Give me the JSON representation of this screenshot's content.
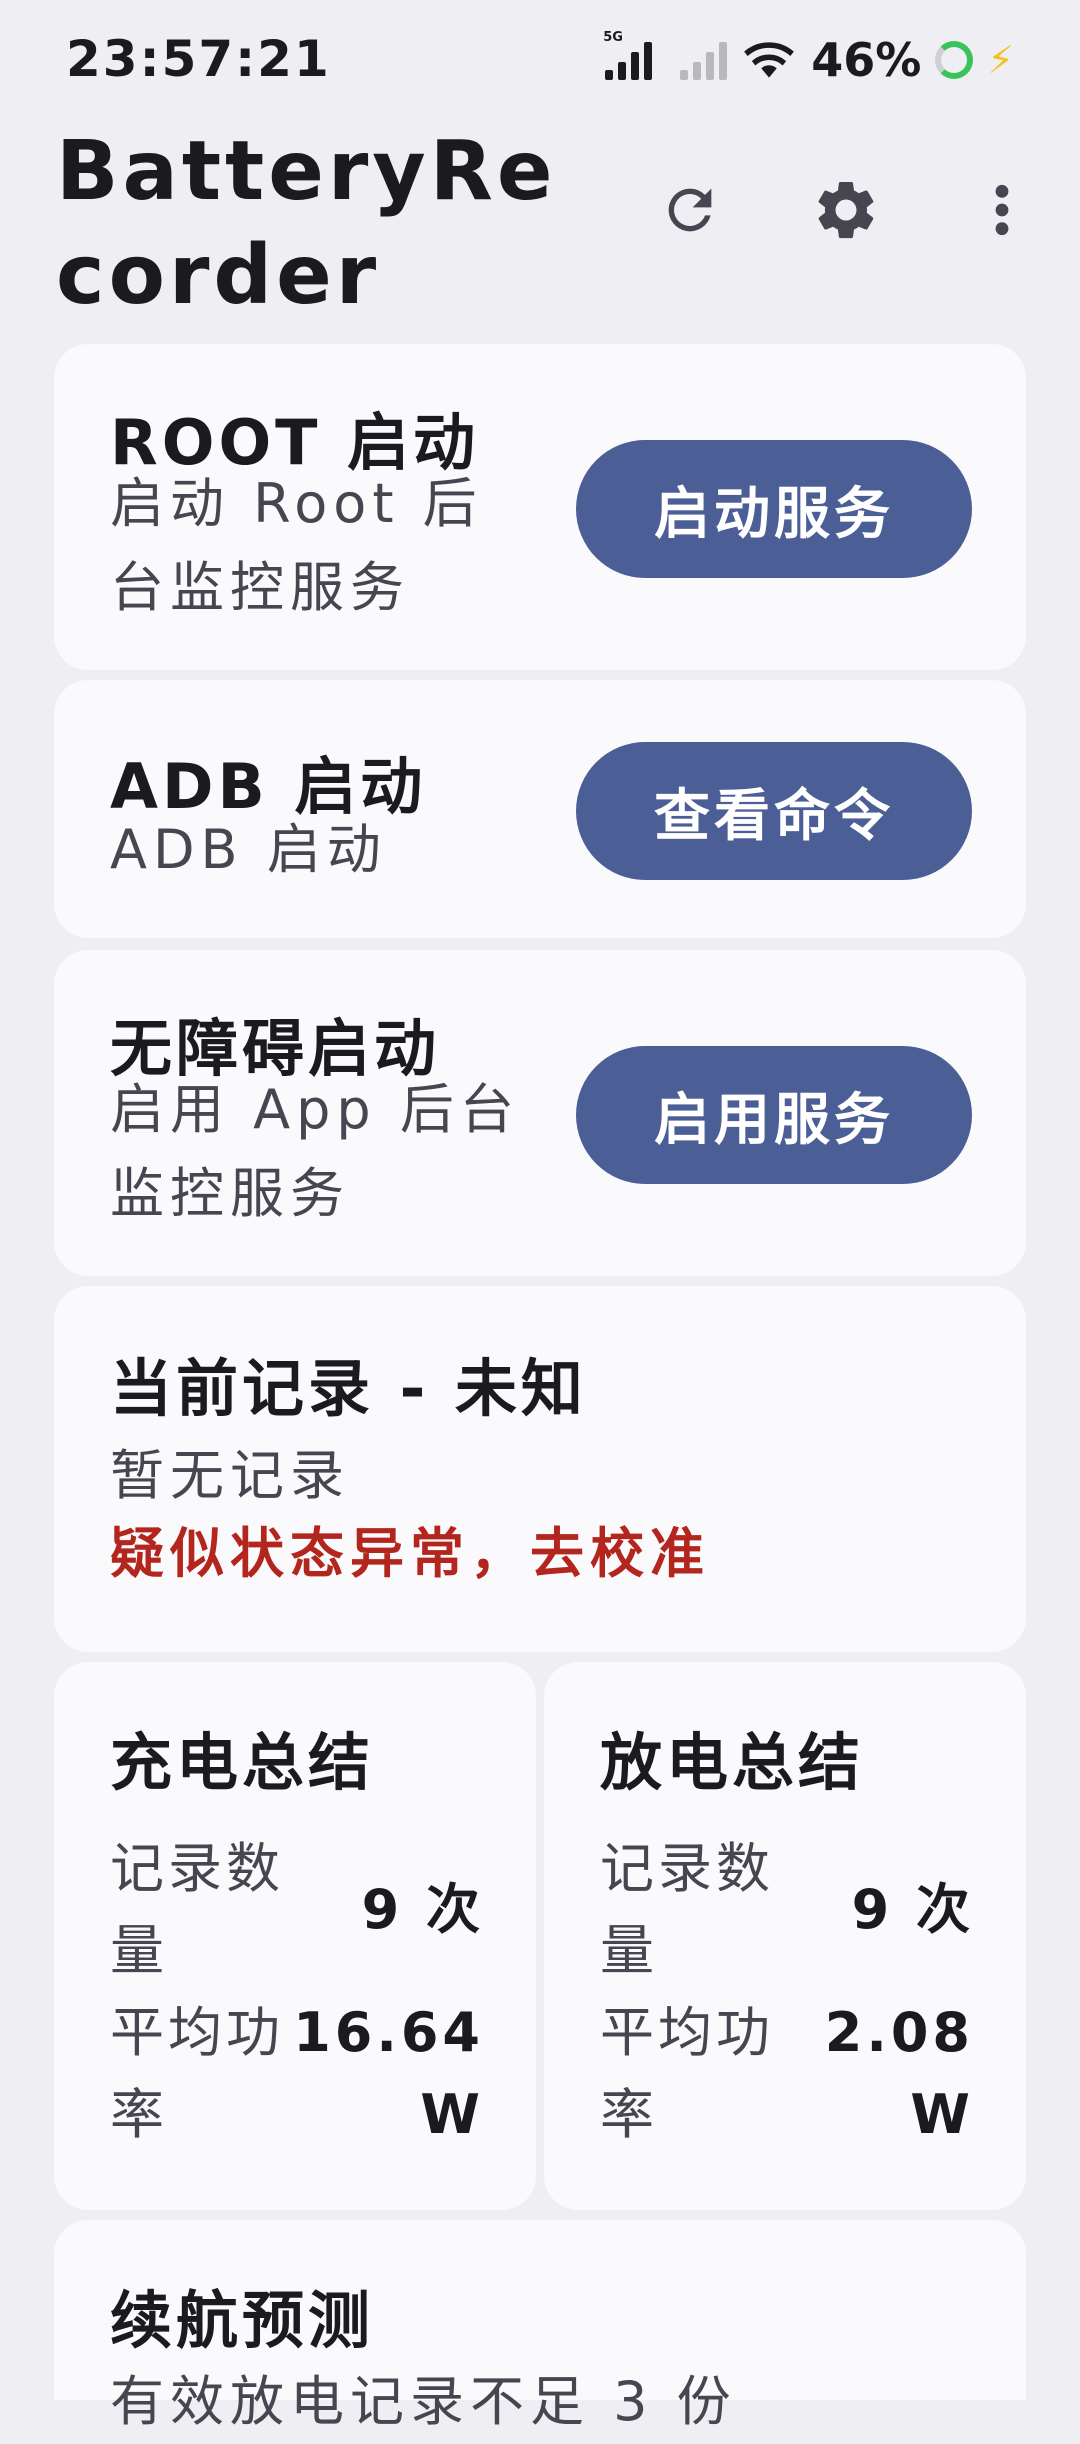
{
  "status_bar": {
    "time": "23:57:21",
    "network_label": "5G",
    "battery_percent": "46%"
  },
  "app_bar": {
    "title": "BatteryRecorder",
    "actions": [
      "refresh-icon",
      "settings-icon",
      "more-vert-icon"
    ]
  },
  "root_card": {
    "title": "ROOT 启动",
    "subtitle": "启动 Root 后台监控服务",
    "button": "启动服务"
  },
  "adb_card": {
    "title": "ADB 启动",
    "subtitle": "ADB 启动",
    "button": "查看命令"
  },
  "a11y_card": {
    "title": "无障碍启动",
    "subtitle": "启用 App 后台监控服务",
    "button": "启用服务"
  },
  "record_card": {
    "title": "当前记录 - 未知",
    "empty": "暂无记录",
    "warning": "疑似状态异常，去校准"
  },
  "charge_summary": {
    "title": "充电总结",
    "count_label": "记录数量",
    "count_value": "9 次",
    "power_label": "平均功率",
    "power_value": "16.64 W"
  },
  "discharge_summary": {
    "title": "放电总结",
    "count_label": "记录数量",
    "count_value": "9 次",
    "power_label": "平均功率",
    "power_value": "2.08 W"
  },
  "prediction_card": {
    "title": "续航预测",
    "text": "有效放电记录不足 3 份"
  },
  "colors": {
    "background": "#eeeef3",
    "card": "#fafafd",
    "button": "#4c5e96",
    "warning": "#b3261e"
  }
}
